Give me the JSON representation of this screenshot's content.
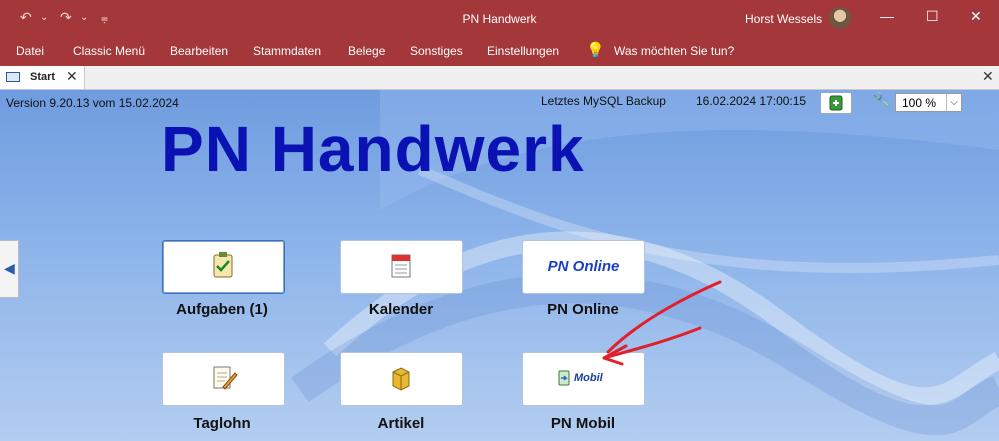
{
  "window": {
    "title": "PN Handwerk",
    "user": "Horst Wessels",
    "controls": {
      "minimize": "—",
      "maximize": "☐",
      "close": "✕"
    },
    "quick_access": {
      "undo": "↶",
      "undo_dd": "⌄",
      "redo": "↷",
      "redo_dd": "⌄",
      "customize": "⩦"
    }
  },
  "menu": {
    "items": [
      "Datei",
      "Classic Menü",
      "Bearbeiten",
      "Stammdaten",
      "Belege",
      "Sonstiges",
      "Einstellungen"
    ],
    "tell_me_icon": "lightbulb-icon",
    "tell_me_glyph": "💡",
    "tell_me": "Was möchten Sie tun?"
  },
  "tabs": {
    "active": "Start",
    "close_glyph": "✕"
  },
  "header": {
    "version": "Version 9.20.13 vom 15.02.2024",
    "backup_label": "Letztes MySQL Backup",
    "backup_date": "16.02.2024 17:00:15",
    "zoom": "100 %",
    "zoom_arrow": "⌵",
    "wrench_glyph": "🔧",
    "side_arrow": "◀"
  },
  "app_title": "PN Handwerk",
  "tiles": {
    "aufgaben": {
      "label": "Aufgaben (1)",
      "icon": "clipboard-check-icon"
    },
    "kalender": {
      "label": "Kalender",
      "icon": "calendar-icon"
    },
    "pn_online": {
      "label": "PN Online",
      "button_text": "PN Online"
    },
    "taglohn": {
      "label": "Taglohn",
      "icon": "notepad-pencil-icon"
    },
    "artikel": {
      "label": "Artikel",
      "icon": "box-icon"
    },
    "pn_mobil": {
      "label": "PN Mobil",
      "button_text": "Mobil",
      "icon": "mobile-sync-icon"
    }
  },
  "colors": {
    "titlebar": "#a4373a",
    "title_text": "#0a12b4",
    "annotation": "#e0202a"
  }
}
